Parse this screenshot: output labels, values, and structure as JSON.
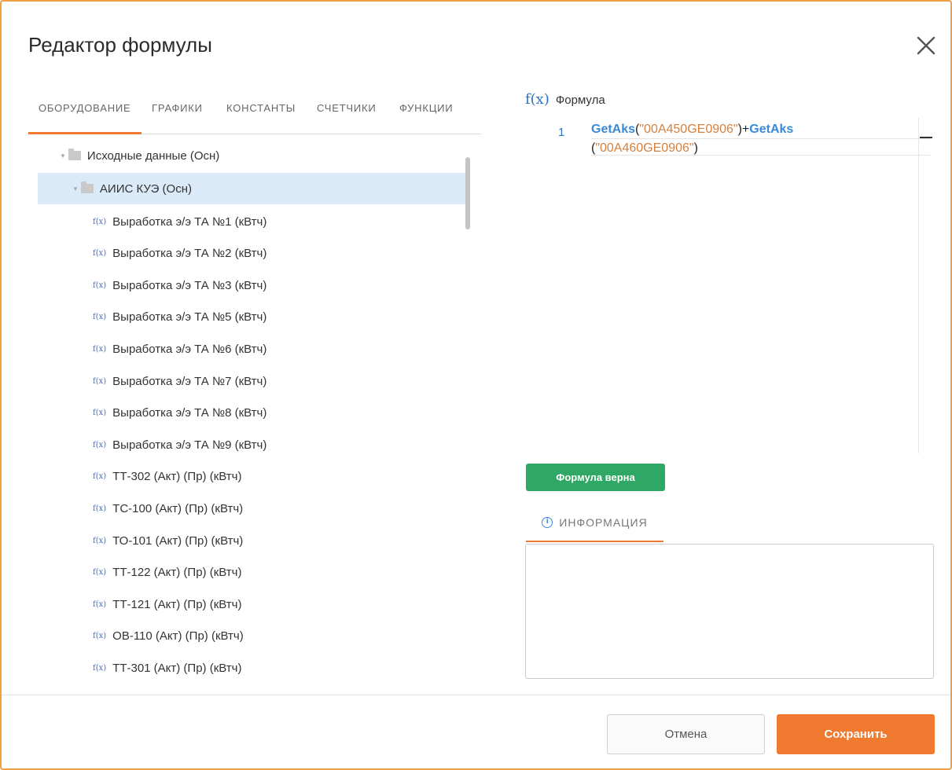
{
  "dialog": {
    "title": "Редактор формулы",
    "close_icon": "close-icon"
  },
  "tabs": [
    {
      "label": "ОБОРУДОВАНИЕ",
      "active": true
    },
    {
      "label": "ГРАФИКИ",
      "active": false
    },
    {
      "label": "КОНСТАНТЫ",
      "active": false
    },
    {
      "label": "СЧЕТЧИКИ",
      "active": false
    },
    {
      "label": "ФУНКЦИИ",
      "active": false
    }
  ],
  "tree": {
    "root": {
      "label": "Исходные данные (Осн)",
      "icon": "folder-icon"
    },
    "group": {
      "label": "АИИС КУЭ (Осн)",
      "icon": "folder-icon",
      "selected": true
    },
    "fx_icon_text": "f(x)",
    "items": [
      "Выработка э/э ТА №1 (кВтч)",
      "Выработка э/э ТА №2 (кВтч)",
      "Выработка э/э ТА №3 (кВтч)",
      "Выработка э/э ТА №5 (кВтч)",
      "Выработка э/э ТА №6 (кВтч)",
      "Выработка э/э ТА №7 (кВтч)",
      "Выработка э/э ТА №8 (кВтч)",
      "Выработка э/э ТА №9 (кВтч)",
      "ТТ-302 (Акт) (Пр) (кВтч)",
      "ТС-100 (Акт) (Пр) (кВтч)",
      "ТО-101 (Акт) (Пр) (кВтч)",
      "ТТ-122 (Акт) (Пр) (кВтч)",
      "ТТ-121 (Акт) (Пр) (кВтч)",
      "ОВ-110 (Акт) (Пр) (кВтч)",
      "ТТ-301 (Акт) (Пр) (кВтч)"
    ]
  },
  "formula": {
    "header_icon": "f(x)",
    "label": "Формула",
    "line_number": "1",
    "code": {
      "fn1": "GetAks",
      "open1": "(",
      "arg1": "\"00A450GE0906\"",
      "close1": ")+",
      "fn2": "GetAks",
      "open2": "(",
      "arg2": "\"00A460GE0906\"",
      "close2": ")"
    }
  },
  "validation": {
    "label": "Формула верна",
    "color": "#2ea864"
  },
  "info": {
    "tab_label": "ИНФОРМАЦИЯ",
    "icon_text": "i",
    "content": ""
  },
  "footer": {
    "cancel_label": "Отмена",
    "save_label": "Сохранить"
  },
  "colors": {
    "accent": "#f07a30",
    "selection": "#dbeaf8",
    "link": "#3a8ad8"
  }
}
